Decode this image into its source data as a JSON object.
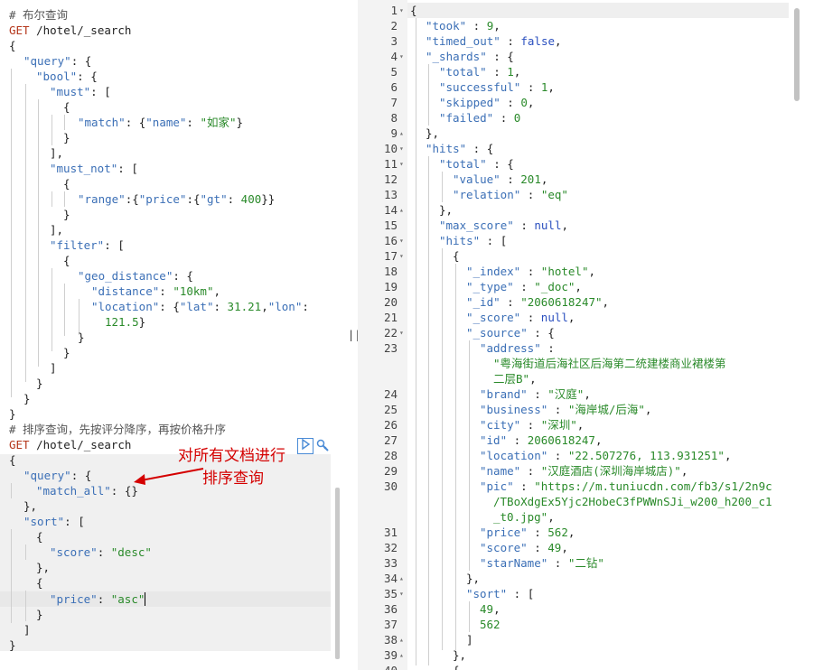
{
  "left_editor": {
    "comment1": "# 布尔查询",
    "req1_method": "GET",
    "req1_path": " /hotel/_search",
    "comment2": "# 排序查询，先按评分降序，再按价格升序",
    "req2_method": "GET",
    "req2_path": " /hotel/_search",
    "q1": {
      "l1": "{",
      "l2a": "\"query\"",
      "l2b": ": {",
      "l3a": "\"bool\"",
      "l3b": ": {",
      "l4a": "\"must\"",
      "l4b": ": [",
      "l5": "{",
      "l6a": "\"match\"",
      "l6b": ": {",
      "l6c": "\"name\"",
      "l6d": ": ",
      "l6e": "\"如家\"",
      "l6f": "}",
      "l7": "}",
      "l8": "],",
      "l9a": "\"must_not\"",
      "l9b": ": [",
      "l10": "{",
      "l11a": "\"range\"",
      "l11b": ":{",
      "l11c": "\"price\"",
      "l11d": ":{",
      "l11e": "\"gt\"",
      "l11f": ": ",
      "l11g": "400",
      "l11h": "}}",
      "l12": "}",
      "l13": "],",
      "l14a": "\"filter\"",
      "l14b": ": [",
      "l15": "{",
      "l16a": "\"geo_distance\"",
      "l16b": ": {",
      "l17a": "\"distance\"",
      "l17b": ": ",
      "l17c": "\"10km\"",
      "l17d": ",",
      "l18a": "\"location\"",
      "l18b": ": {",
      "l18c": "\"lat\"",
      "l18d": ": ",
      "l18e": "31.21",
      "l18f": ",",
      "l18g": "\"lon\"",
      "l18h": ":",
      "l19a": "121.5",
      "l19b": "}",
      "l20": "}",
      "l21": "}",
      "l22": "]",
      "l23": "}",
      "l24": "}",
      "l25": "}"
    },
    "q2": {
      "l1": "{",
      "l2a": "\"query\"",
      "l2b": ": {",
      "l3a": "\"match_all\"",
      "l3b": ": {}",
      "l4": "},",
      "l5a": "\"sort\"",
      "l5b": ": [",
      "l6": "{",
      "l7a": "\"score\"",
      "l7b": ": ",
      "l7c": "\"desc\"",
      "l8": "},",
      "l9": "{",
      "l10a": "\"price\"",
      "l10b": ": ",
      "l10c": "\"asc\"",
      "l11": "}",
      "l12": "]",
      "l13": "}"
    },
    "annotation_line1": "对所有文档进行",
    "annotation_line2": "排序查询"
  },
  "right_editor": {
    "line_numbers": [
      "1",
      "2",
      "3",
      "4",
      "5",
      "6",
      "7",
      "8",
      "9",
      "10",
      "11",
      "12",
      "13",
      "14",
      "15",
      "16",
      "17",
      "18",
      "19",
      "20",
      "21",
      "22",
      "23",
      "",
      "24",
      "25",
      "26",
      "27",
      "28",
      "29",
      "30",
      "",
      "",
      "31",
      "32",
      "33",
      "34",
      "35",
      "36",
      "37",
      "38",
      "39",
      "40"
    ],
    "r1": "{",
    "r2a": "\"took\"",
    "r2b": " : ",
    "r2c": "9",
    "r2d": ",",
    "r3a": "\"timed_out\"",
    "r3b": " : ",
    "r3c": "false",
    "r3d": ",",
    "r4a": "\"_shards\"",
    "r4b": " : {",
    "r5a": "\"total\"",
    "r5b": " : ",
    "r5c": "1",
    "r5d": ",",
    "r6a": "\"successful\"",
    "r6b": " : ",
    "r6c": "1",
    "r6d": ",",
    "r7a": "\"skipped\"",
    "r7b": " : ",
    "r7c": "0",
    "r7d": ",",
    "r8a": "\"failed\"",
    "r8b": " : ",
    "r8c": "0",
    "r9": "},",
    "r10a": "\"hits\"",
    "r10b": " : {",
    "r11a": "\"total\"",
    "r11b": " : {",
    "r12a": "\"value\"",
    "r12b": " : ",
    "r12c": "201",
    "r12d": ",",
    "r13a": "\"relation\"",
    "r13b": " : ",
    "r13c": "\"eq\"",
    "r14": "},",
    "r15a": "\"max_score\"",
    "r15b": " : ",
    "r15c": "null",
    "r15d": ",",
    "r16a": "\"hits\"",
    "r16b": " : [",
    "r17": "{",
    "r18a": "\"_index\"",
    "r18b": " : ",
    "r18c": "\"hotel\"",
    "r18d": ",",
    "r19a": "\"_type\"",
    "r19b": " : ",
    "r19c": "\"_doc\"",
    "r19d": ",",
    "r20a": "\"_id\"",
    "r20b": " : ",
    "r20c": "\"2060618247\"",
    "r20d": ",",
    "r21a": "\"_score\"",
    "r21b": " : ",
    "r21c": "null",
    "r21d": ",",
    "r22a": "\"_source\"",
    "r22b": " : {",
    "r23a": "\"address\"",
    "r23b": " :",
    "r23c": "\"粤海街道后海社区后海第二统建楼商业裙楼第",
    "r23d": "二层B\"",
    "r23e": ",",
    "r24a": "\"brand\"",
    "r24b": " : ",
    "r24c": "\"汉庭\"",
    "r24d": ",",
    "r25a": "\"business\"",
    "r25b": " : ",
    "r25c": "\"海岸城/后海\"",
    "r25d": ",",
    "r26a": "\"city\"",
    "r26b": " : ",
    "r26c": "\"深圳\"",
    "r26d": ",",
    "r27a": "\"id\"",
    "r27b": " : ",
    "r27c": "2060618247",
    "r27d": ",",
    "r28a": "\"location\"",
    "r28b": " : ",
    "r28c": "\"22.507276, 113.931251\"",
    "r28d": ",",
    "r29a": "\"name\"",
    "r29b": " : ",
    "r29c": "\"汉庭酒店(深圳海岸城店)\"",
    "r29d": ",",
    "r30a": "\"pic\"",
    "r30b": " : ",
    "r30c": "\"https://m.tuniucdn.com/fb3/s1/2n9c",
    "r30d": "/TBoXdgEx5Yjc2HobeC3fPWWnSJi_w200_h200_c1",
    "r30e": "_t0.jpg\"",
    "r30f": ",",
    "r31a": "\"price\"",
    "r31b": " : ",
    "r31c": "562",
    "r31d": ",",
    "r32a": "\"score\"",
    "r32b": " : ",
    "r32c": "49",
    "r32d": ",",
    "r33a": "\"starName\"",
    "r33b": " : ",
    "r33c": "\"二钻\"",
    "r34": "},",
    "r35a": "\"sort\"",
    "r35b": " : [",
    "r36a": "49",
    "r36b": ",",
    "r37": "562",
    "r38": "]",
    "r39": "},",
    "r40": "{"
  },
  "divider_glyph": "||",
  "toolbar": {
    "run_icon": "play-icon",
    "settings_icon": "wrench-icon"
  }
}
